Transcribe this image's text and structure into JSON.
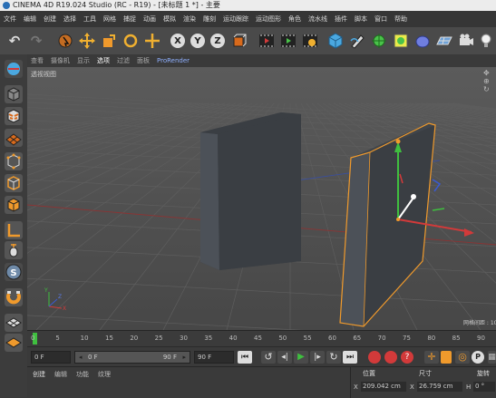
{
  "window": {
    "title": "CINEMA 4D R19.024 Studio (RC - R19) - [未标题 1 *] - 主要"
  },
  "menu": [
    "文件",
    "编辑",
    "创建",
    "选择",
    "工具",
    "网格",
    "捕捉",
    "动画",
    "模拟",
    "渲染",
    "雕刻",
    "运动跟踪",
    "运动图形",
    "角色",
    "流水线",
    "插件",
    "脚本",
    "窗口",
    "帮助"
  ],
  "viewport": {
    "menu": [
      "查看",
      "摄像机",
      "显示",
      "选项",
      "过滤",
      "面板",
      "ProRender"
    ],
    "active_menu": "选项",
    "label": "透视视图",
    "grid_spacing_label": "网格间距 : 100 cm"
  },
  "timeline": {
    "ticks": [
      "0",
      "5",
      "10",
      "15",
      "20",
      "25",
      "30",
      "35",
      "40",
      "45",
      "50",
      "55",
      "60",
      "65",
      "70",
      "75",
      "80",
      "85",
      "90"
    ]
  },
  "transport": {
    "start_frame": "0 F",
    "current_frame": "0 F",
    "range_end": "90 F",
    "end_frame": "90 F"
  },
  "bottom": {
    "tabs": [
      "创建",
      "编辑",
      "功能",
      "纹理"
    ],
    "coord_headers": [
      "位置",
      "尺寸",
      "旋转"
    ],
    "coords": {
      "x_label": "X",
      "x_pos": "209.042 cm",
      "x2_label": "X",
      "x_size": "26.759 cm",
      "h_label": "H",
      "h_rot": "0 °"
    }
  },
  "colors": {
    "accent_orange": "#f09a2c",
    "axis_x": "#d23a3a",
    "axis_y": "#3fbf3f",
    "axis_z": "#3a5ad2",
    "viewport_bg": "#4d4d4d"
  }
}
